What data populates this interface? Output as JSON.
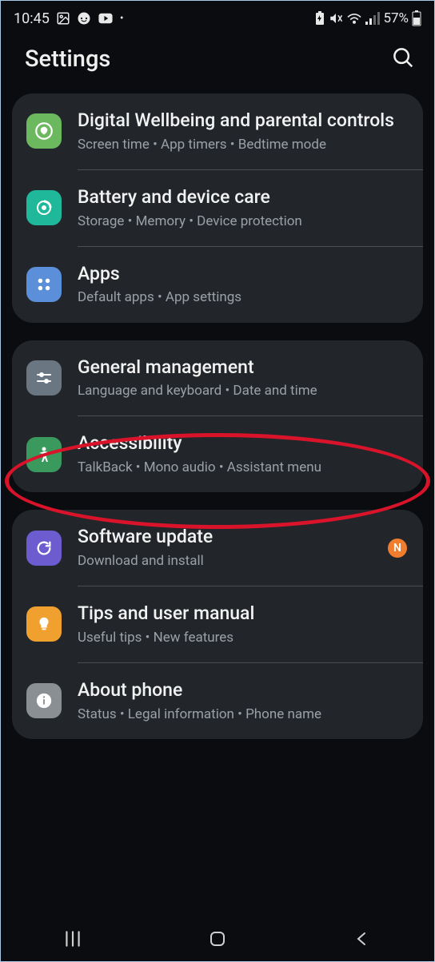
{
  "statusbar": {
    "time": "10:45",
    "battery_text": "57%"
  },
  "header": {
    "title": "Settings"
  },
  "groups": [
    {
      "items": [
        {
          "title": "Digital Wellbeing and parental controls",
          "sub": "Screen time  •  App timers  •  Bedtime mode"
        },
        {
          "title": "Battery and device care",
          "sub": "Storage  •  Memory  •  Device protection"
        },
        {
          "title": "Apps",
          "sub": "Default apps  •  App settings"
        }
      ]
    },
    {
      "items": [
        {
          "title": "General management",
          "sub": "Language and keyboard  •  Date and time"
        },
        {
          "title": "Accessibility",
          "sub": "TalkBack  •  Mono audio  •  Assistant menu"
        }
      ]
    },
    {
      "items": [
        {
          "title": "Software update",
          "sub": "Download and install",
          "badge": "N"
        },
        {
          "title": "Tips and user manual",
          "sub": "Useful tips  •  New features"
        },
        {
          "title": "About phone",
          "sub": "Status  •  Legal information  •  Phone name"
        }
      ]
    }
  ]
}
